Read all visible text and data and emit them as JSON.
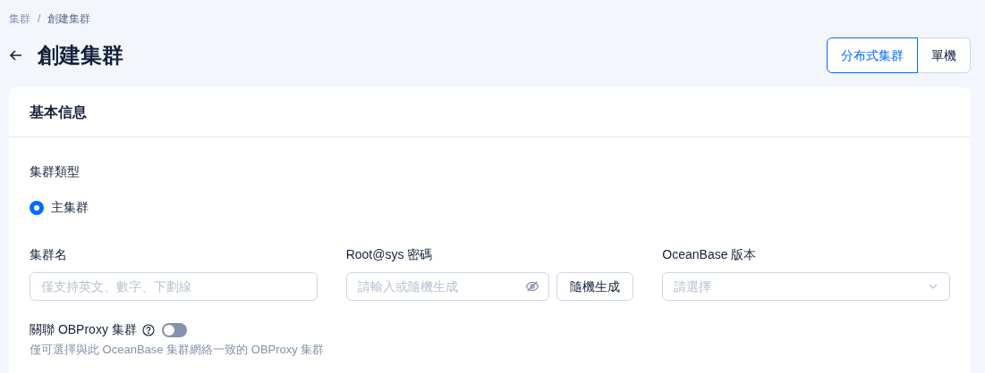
{
  "breadcrumb": [
    "集群",
    "創建集群"
  ],
  "breadcrumb_separator": "/",
  "title": "創建集群",
  "mode_tabs": [
    {
      "label": "分布式集群",
      "selected": true
    },
    {
      "label": "單機",
      "selected": false
    }
  ],
  "card": {
    "title": "基本信息",
    "cluster_type": {
      "label": "集群類型",
      "options": [
        {
          "label": "主集群",
          "selected": true
        }
      ]
    },
    "fields": [
      {
        "kind": "text",
        "label": "集群名",
        "placeholder": "僅支持英文、數字、下劃線"
      },
      {
        "kind": "password",
        "label": "Root@sys 密碼",
        "placeholder": "請輸入或隨機生成",
        "button": "隨機生成"
      },
      {
        "kind": "select",
        "label": "OceanBase 版本",
        "placeholder": "請選擇"
      }
    ],
    "obproxy": {
      "label": "關聯 OBProxy 集群",
      "on": false,
      "hint": "僅可選擇與此 OceanBase 集群網絡一致的 OBProxy 集群"
    }
  }
}
